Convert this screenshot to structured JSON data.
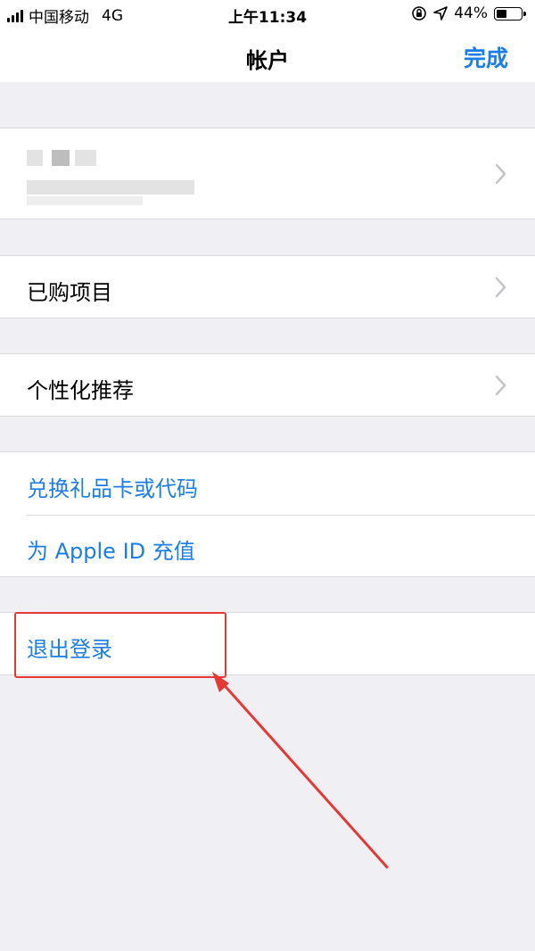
{
  "status_bar": {
    "carrier": "中国移动",
    "network": "4G",
    "time": "上午11:34",
    "battery": "44%",
    "battery_level": 0.44
  },
  "nav": {
    "title": "帐户",
    "done_label": "完成"
  },
  "account": {
    "name_redacted": true
  },
  "items": {
    "purchased": "已购项目",
    "personalized": "个性化推荐",
    "redeem": "兑换礼品卡或代码",
    "add_funds": "为 Apple ID 充值",
    "sign_out": "退出登录"
  },
  "colors": {
    "accent": "#1a7ee6",
    "background": "#efeff4",
    "annotation": "#e53935"
  }
}
